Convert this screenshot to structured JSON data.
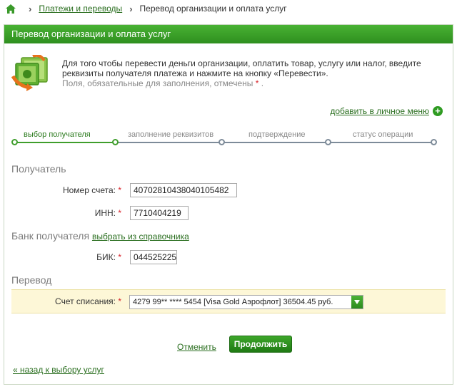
{
  "breadcrumb": {
    "home_icon": "home-icon",
    "items": [
      "Платежи и переводы",
      "Перевод организации и оплата услуг"
    ]
  },
  "panel": {
    "title": "Перевод организации и оплата услуг",
    "intro_text": "Для того чтобы перевести деньги организации, оплатить товар, услугу или налог, введите реквизиты получателя платежа и нажмите на кнопку «Перевести».",
    "intro_hint": "Поля, обязательные для заполнения, отмечены",
    "required_mark": "*",
    "hint_end": "."
  },
  "add_menu": {
    "label": "добавить в личное меню",
    "icon": "plus-circle-icon",
    "icon_glyph": "+"
  },
  "steps": [
    {
      "label": "выбор получателя",
      "active": true
    },
    {
      "label": "заполнение реквизитов",
      "active": false
    },
    {
      "label": "подтверждение",
      "active": false
    },
    {
      "label": "статус операции",
      "active": false
    }
  ],
  "recipient": {
    "section_title": "Получатель",
    "account_label": "Номер счета:",
    "account_value": "40702810438040105482",
    "inn_label": "ИНН:",
    "inn_value": "7710404219"
  },
  "bank": {
    "section_title": "Банк получателя",
    "dict_link": "выбрать из справочника",
    "bik_label": "БИК:",
    "bik_value": "044525225"
  },
  "transfer": {
    "section_title": "Перевод",
    "debit_label": "Счет списания:",
    "debit_value": "4279 99** **** 5454 [Visa Gold Аэрофлот] 36504.45 руб."
  },
  "actions": {
    "cancel": "Отменить",
    "continue": "Продолжить",
    "back": "« назад к выбору услуг"
  },
  "colors": {
    "brand_green": "#2f8f1f",
    "link_green": "#2a6e1f",
    "required_red": "#d8232a"
  }
}
